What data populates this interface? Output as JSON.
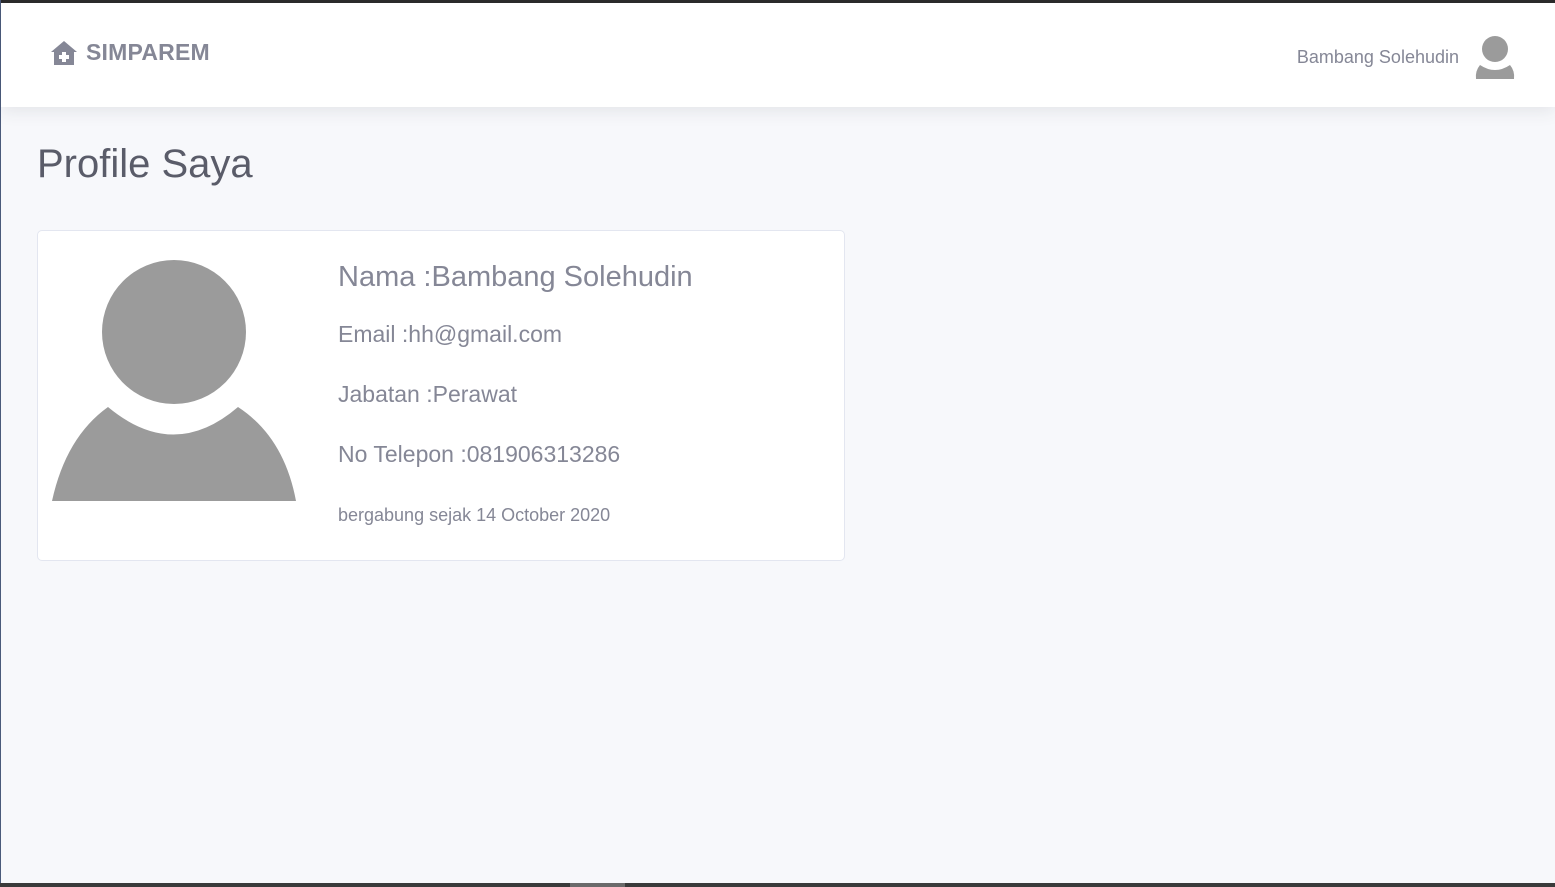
{
  "app": {
    "brand": "SIMPAREM",
    "brand_icon": "home-medical-icon"
  },
  "user_menu": {
    "name": "Bambang Solehudin",
    "avatar_icon": "user-avatar-icon"
  },
  "page": {
    "title": "Profile Saya"
  },
  "profile": {
    "photo_icon": "user-silhouette-icon",
    "nama": "Nama :Bambang Solehudin",
    "email": "Email :hh@gmail.com",
    "jabatan": "Jabatan :Perawat",
    "telepon": "No Telepon :081906313286",
    "joined": "bergabung sejak 14 October 2020"
  },
  "colors": {
    "text_gray": "#858796",
    "heading": "#5a5c69",
    "background": "#f7f8fb",
    "avatar_gray": "#9b9b9b"
  }
}
